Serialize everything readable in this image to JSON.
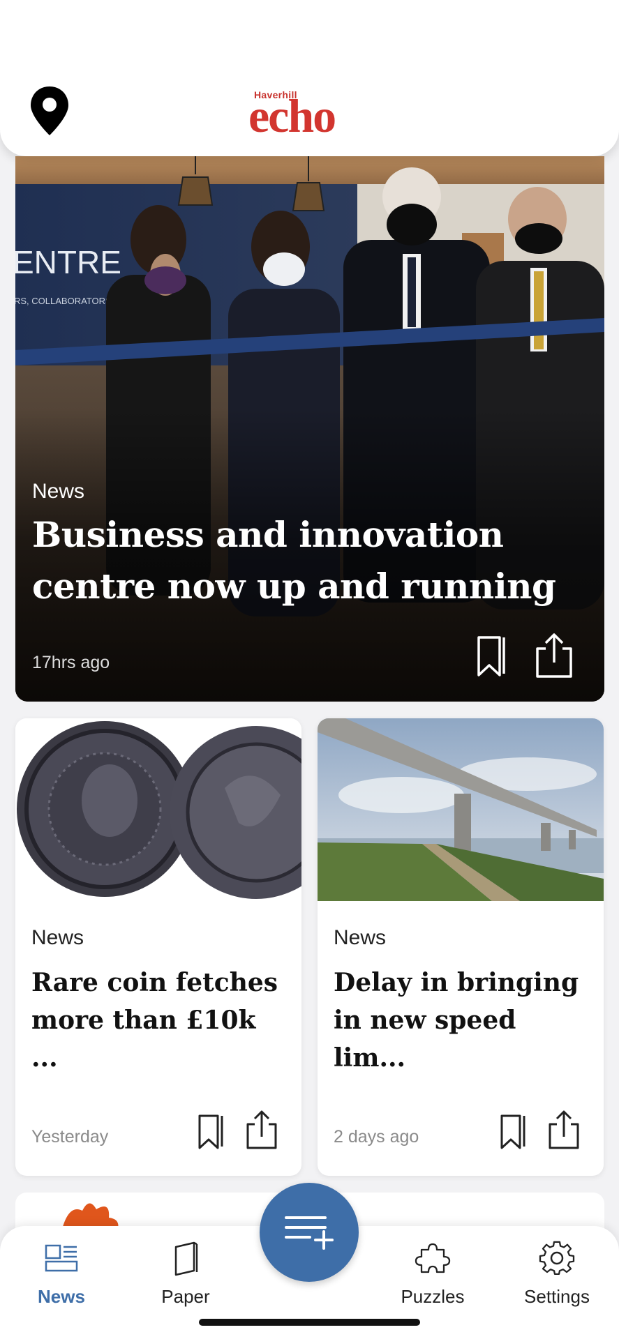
{
  "header": {
    "brand_top": "Haverhill",
    "brand_main": "echo",
    "location_icon": "map-pin-icon"
  },
  "hero": {
    "category": "News",
    "title": "Business and innovation centre now up and running",
    "time": "17hrs ago",
    "sign_text": "ENTRE",
    "sign_subtext": "RS, COLLABORATORS"
  },
  "cards": [
    {
      "category": "News",
      "title": "Rare coin fetches more than £10k ...",
      "time": "Yesterday"
    },
    {
      "category": "News",
      "title": "Delay in bringing in new speed lim...",
      "time": "2 days ago"
    }
  ],
  "nav": {
    "news": "News",
    "paper": "Paper",
    "puzzles": "Puzzles",
    "settings": "Settings"
  },
  "colors": {
    "brand_red": "#d2352f",
    "accent_blue": "#3e6ea8"
  }
}
